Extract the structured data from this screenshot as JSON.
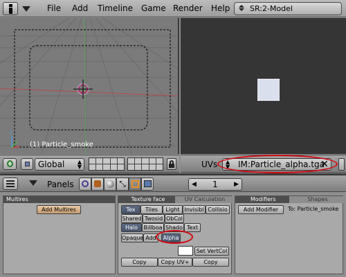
{
  "menubar": {
    "items": [
      "File",
      "Add",
      "Timeline",
      "Game",
      "Render",
      "Help"
    ],
    "scene_value": "SR:2-Model"
  },
  "viewport": {
    "object_label": "(1) Particle_smoke",
    "orientation_value": "Global"
  },
  "uv_editor": {
    "label": "UVs",
    "image_value": "IM:Particle_alpha.tga"
  },
  "buttons_header": {
    "panels_label": "Panels",
    "frame_value": "1"
  },
  "multires_panel": {
    "tab": "Multires",
    "add_button": "Add Multires"
  },
  "texface_panel": {
    "tabs": [
      "Texture face",
      "UV Calculation"
    ],
    "row1": [
      "Tex",
      "Tiles",
      "Light",
      "Invisibl",
      "Collisio"
    ],
    "row2": [
      "Shared",
      "Twosid",
      "ObCol"
    ],
    "row3": [
      "Halo",
      "Billboa",
      "Shado",
      "Text"
    ],
    "row4": [
      "Opaque",
      "Add",
      "Alpha"
    ],
    "set_vertcol": "Set VertCol",
    "copy_buttons": [
      "Copy DrawMo",
      "Copy UV+",
      "Copy VertCol"
    ]
  },
  "modifiers_panel": {
    "tabs": [
      "Modifiers",
      "Shapes"
    ],
    "add_button": "Add Modifier",
    "to_label": "To: Particle_smoke"
  },
  "colors": {
    "highlight": "#d10a12",
    "active_button": "#4e5a73",
    "uv_background": "#353535",
    "viewport": "#7b7b7b"
  }
}
